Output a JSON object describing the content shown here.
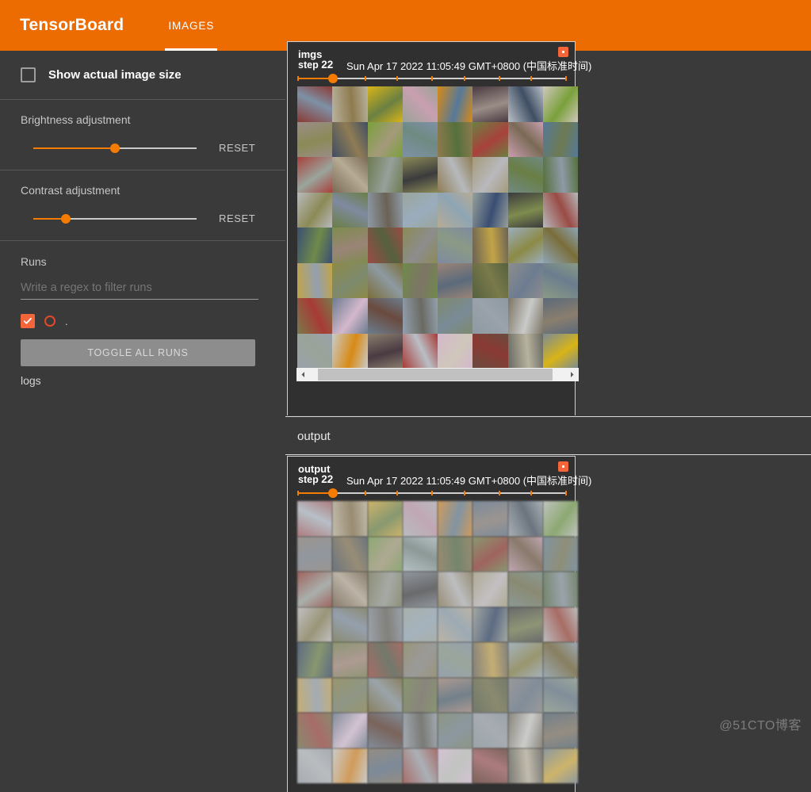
{
  "header": {
    "brand": "TensorBoard",
    "tabs": [
      {
        "label": "IMAGES",
        "active": true
      }
    ]
  },
  "sidebar": {
    "show_actual_size": {
      "label": "Show actual image size",
      "checked": false,
      "icon": "checkbox-icon"
    },
    "brightness": {
      "label": "Brightness adjustment",
      "reset_label": "RESET",
      "value_pct": 50
    },
    "contrast": {
      "label": "Contrast adjustment",
      "reset_label": "RESET",
      "value_pct": 20
    },
    "runs": {
      "title": "Runs",
      "filter_placeholder": "Write a regex to filter runs",
      "filter_value": "",
      "selector_checkbox_checked": true,
      "selector_dot_label": ".",
      "toggle_all_label": "TOGGLE ALL RUNS",
      "items": [
        {
          "label": "logs"
        }
      ]
    }
  },
  "main": {
    "sections": [
      {
        "category_label": "imgs",
        "card": {
          "title": "imgs",
          "step_label": "step",
          "step_value": "22",
          "timestamp": "Sun Apr 17 2022 11:05:49 GMT+0800 (中国标准时间)",
          "run_chip_color": "#f4663a",
          "slider": {
            "value_pct": 13,
            "ticks_pct": [
              0,
              13,
              25,
              37,
              50,
              62,
              75,
              87,
              100
            ]
          },
          "grid": {
            "cols": 8,
            "rows": 8
          },
          "scrollbar": {
            "thumb_left_pct": 3,
            "thumb_width_pct": 92,
            "left_icon": "chevron-left-icon",
            "right_icon": "chevron-right-icon"
          }
        }
      },
      {
        "category_label": "output",
        "card": {
          "title": "output",
          "step_label": "step",
          "step_value": "22",
          "timestamp": "Sun Apr 17 2022 11:05:49 GMT+0800 (中国标准时间)",
          "run_chip_color": "#f4663a",
          "slider": {
            "value_pct": 13,
            "ticks_pct": [
              0,
              13,
              25,
              37,
              50,
              62,
              75,
              87,
              100
            ]
          },
          "grid": {
            "cols": 8,
            "rows": 8
          }
        }
      }
    ]
  },
  "watermark": "@51CTO博客",
  "colors": {
    "brand_orange": "#ed6c02",
    "accent_orange": "#f57c00",
    "run_orange": "#f4663a",
    "background_dark": "#3a3a3a",
    "card_dark": "#303030"
  },
  "image_grids": {
    "imgs": [
      [
        "#8a3a33",
        "#b8b39f",
        "#d8b417",
        "#9aa398",
        "#d88a15",
        "#4a3a42",
        "#b9bfc6",
        "#cfc7bb"
      ],
      [
        "#9a8d86",
        "#3f4e63",
        "#7aa03a",
        "#7e91a6",
        "#8e7a4e",
        "#6b8042",
        "#c99fb0",
        "#55799a"
      ],
      [
        "#a8413c",
        "#7a6a55",
        "#6d7a52",
        "#8b8a57",
        "#8f7c54",
        "#a49a7b",
        "#6f8a82",
        "#55703d"
      ],
      [
        "#b9b9bd",
        "#6a7e45",
        "#8e9aa6",
        "#9aa59c",
        "#b6ab95",
        "#97a09a",
        "#3b3b3d",
        "#b6b9bc"
      ],
      [
        "#3a4e73",
        "#7e8c4e",
        "#9a4b45",
        "#8b8a56",
        "#7f8aa0",
        "#6a6255",
        "#9aadbe",
        "#8ea5b5"
      ],
      [
        "#c2a447",
        "#8c8a46",
        "#7a6e3a",
        "#6f8a4a",
        "#9a8477",
        "#55613f",
        "#8d8d8d",
        "#8a9a85"
      ],
      [
        "#7a7a4a",
        "#6c7c90",
        "#6b7d8e",
        "#93a0ae",
        "#7d8a6e",
        "#8e9aa2",
        "#7d7566",
        "#5b6a7a"
      ],
      [
        "#9aa2ab",
        "#c9cbc9",
        "#8a7e6e",
        "#a83a36",
        "#d4b8cc",
        "#6a4a3e",
        "#6a6a62",
        "#7a8b97"
      ]
    ],
    "output": [
      [
        "#b37a7e",
        "#c3bcab",
        "#d2b45e",
        "#b8bcc0",
        "#d99a4e",
        "#7a8a9c",
        "#a9b1b8",
        "#c0c4c0"
      ],
      [
        "#9c958f",
        "#6a7480",
        "#89aa6a",
        "#b6c0c8",
        "#9a8b6c",
        "#86996a",
        "#c4a6b4",
        "#7e94a6"
      ],
      [
        "#a8615c",
        "#8a7a68",
        "#8e8f74",
        "#9097a0",
        "#9a8d72",
        "#b0a98f",
        "#8a9a95",
        "#72876a"
      ],
      [
        "#c3c0c2",
        "#8a8a6e",
        "#9aa3ac",
        "#a9b0ab",
        "#bdb4a4",
        "#a5aaa5",
        "#6a6a6c",
        "#bcbec0"
      ],
      [
        "#5a6b86",
        "#8d9670",
        "#b06a62",
        "#9a9574",
        "#94a0b0",
        "#82807a",
        "#a3b3c0",
        "#9aaab6"
      ],
      [
        "#c8ae6a",
        "#9a9668",
        "#8a7f5a",
        "#86986a",
        "#b09a90",
        "#72796a",
        "#9a9a9a",
        "#9aa79a"
      ],
      [
        "#8a8a6a",
        "#808d9c",
        "#7f8e9c",
        "#a2acb6",
        "#8d9682",
        "#9aa4aa",
        "#8a847a",
        "#70808c"
      ],
      [
        "#a6acb3",
        "#cbcdcb",
        "#968d80",
        "#b06a66",
        "#d6c2d4",
        "#7e6258",
        "#7a7a74",
        "#8a98a2"
      ]
    ]
  }
}
